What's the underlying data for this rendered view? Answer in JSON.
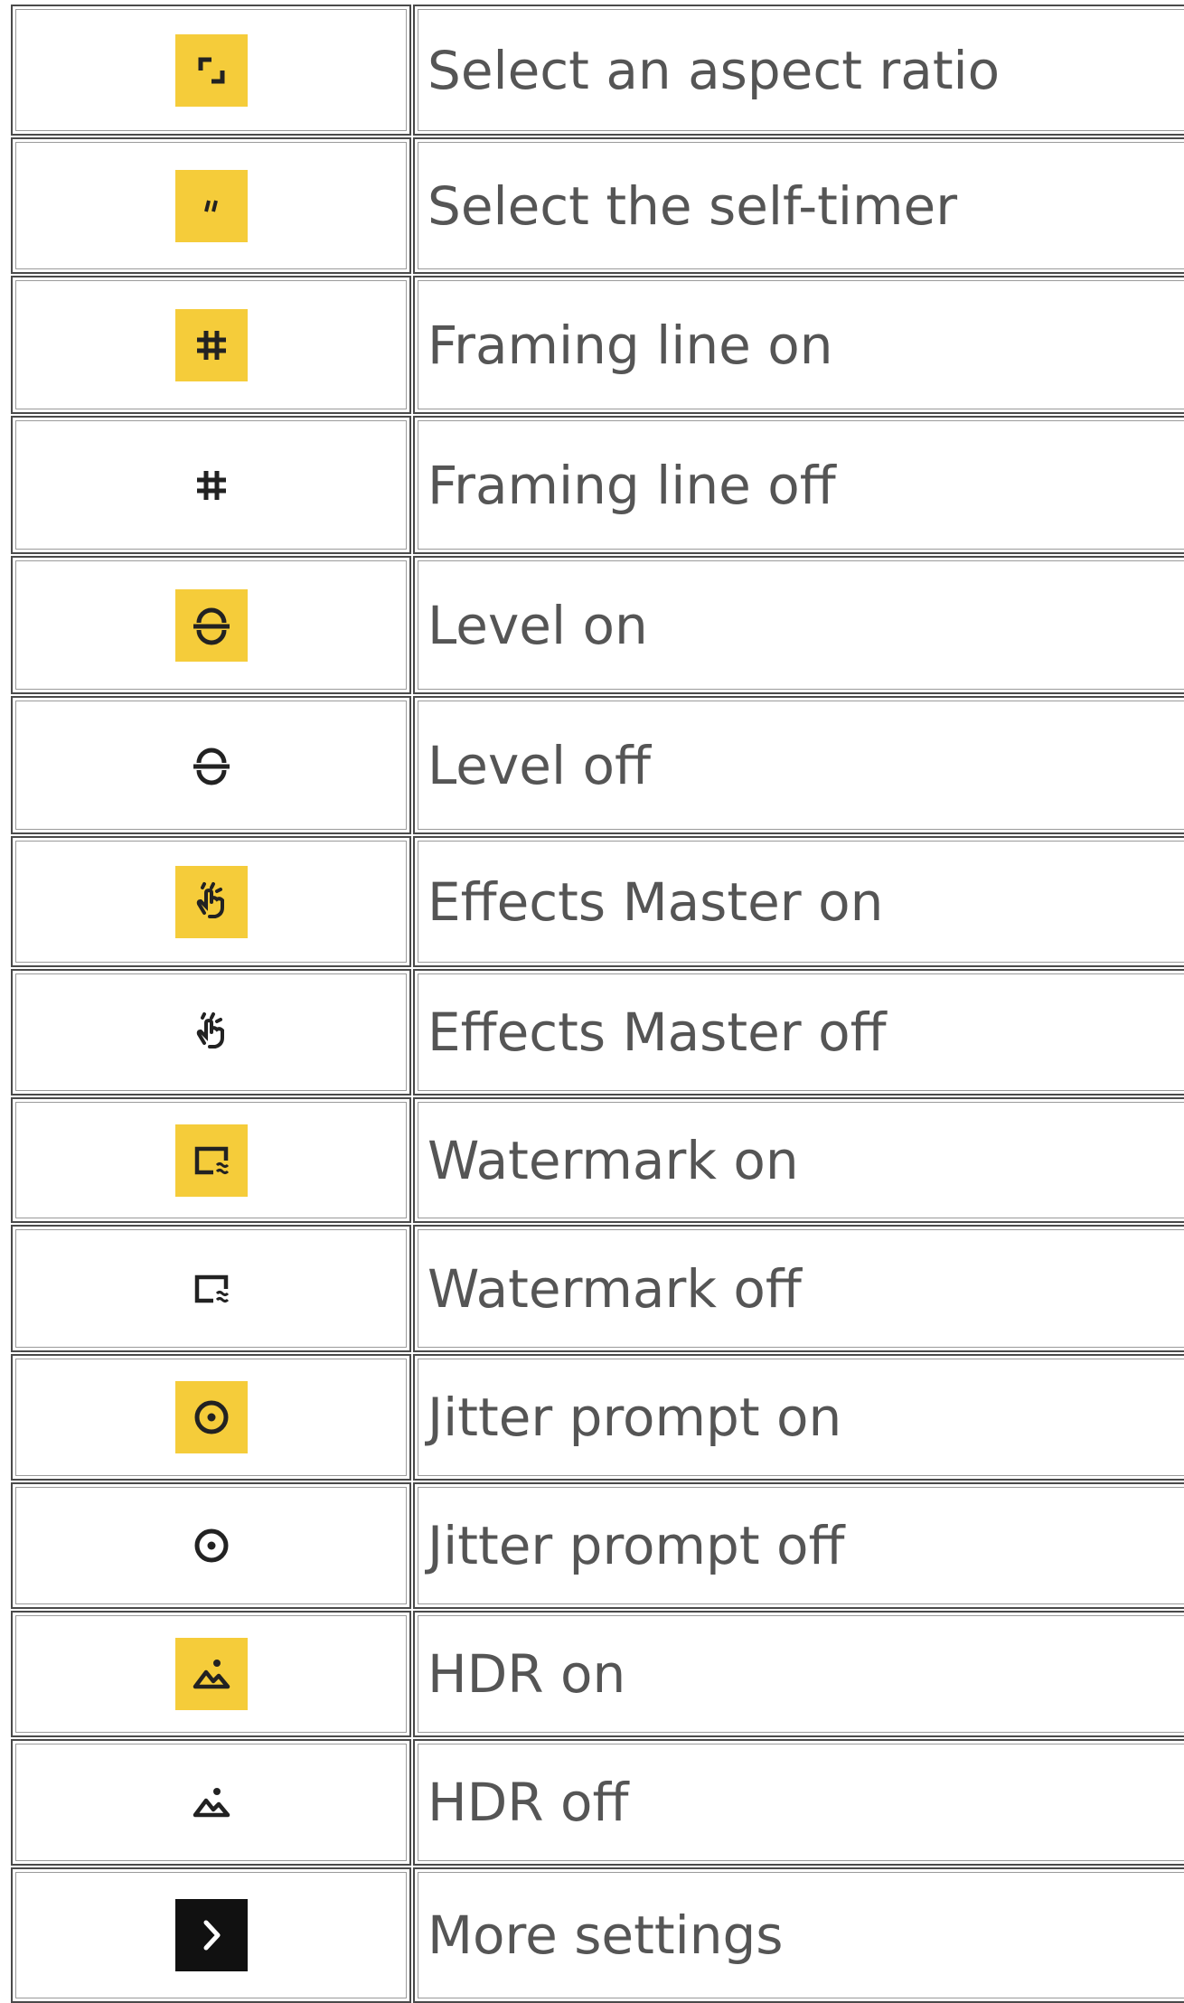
{
  "table": {
    "rows": [
      {
        "icon": "aspect-ratio-icon",
        "active": true,
        "label": "Select an aspect ratio"
      },
      {
        "icon": "self-timer-icon",
        "active": true,
        "label": "Select the self-timer"
      },
      {
        "icon": "framing-line-icon",
        "active": true,
        "label": "Framing line on"
      },
      {
        "icon": "framing-line-icon",
        "active": false,
        "label": "Framing line off"
      },
      {
        "icon": "level-icon",
        "active": true,
        "label": "Level on"
      },
      {
        "icon": "level-icon",
        "active": false,
        "label": "Level off"
      },
      {
        "icon": "effects-master-icon",
        "active": true,
        "label": "Effects Master on"
      },
      {
        "icon": "effects-master-icon",
        "active": false,
        "label": "Effects Master off"
      },
      {
        "icon": "watermark-icon",
        "active": true,
        "label": "Watermark on"
      },
      {
        "icon": "watermark-icon",
        "active": false,
        "label": "Watermark off"
      },
      {
        "icon": "jitter-prompt-icon",
        "active": true,
        "label": "Jitter prompt on"
      },
      {
        "icon": "jitter-prompt-icon",
        "active": false,
        "label": "Jitter prompt off"
      },
      {
        "icon": "hdr-icon",
        "active": true,
        "label": "HDR on"
      },
      {
        "icon": "hdr-icon",
        "active": false,
        "label": "HDR off"
      },
      {
        "icon": "chevron-right-icon",
        "active": true,
        "label": "More settings"
      }
    ]
  },
  "colors": {
    "active_bg": "#f5cc3a",
    "more_bg": "#111111",
    "text": "#555555",
    "border": "#4a4a4a"
  }
}
